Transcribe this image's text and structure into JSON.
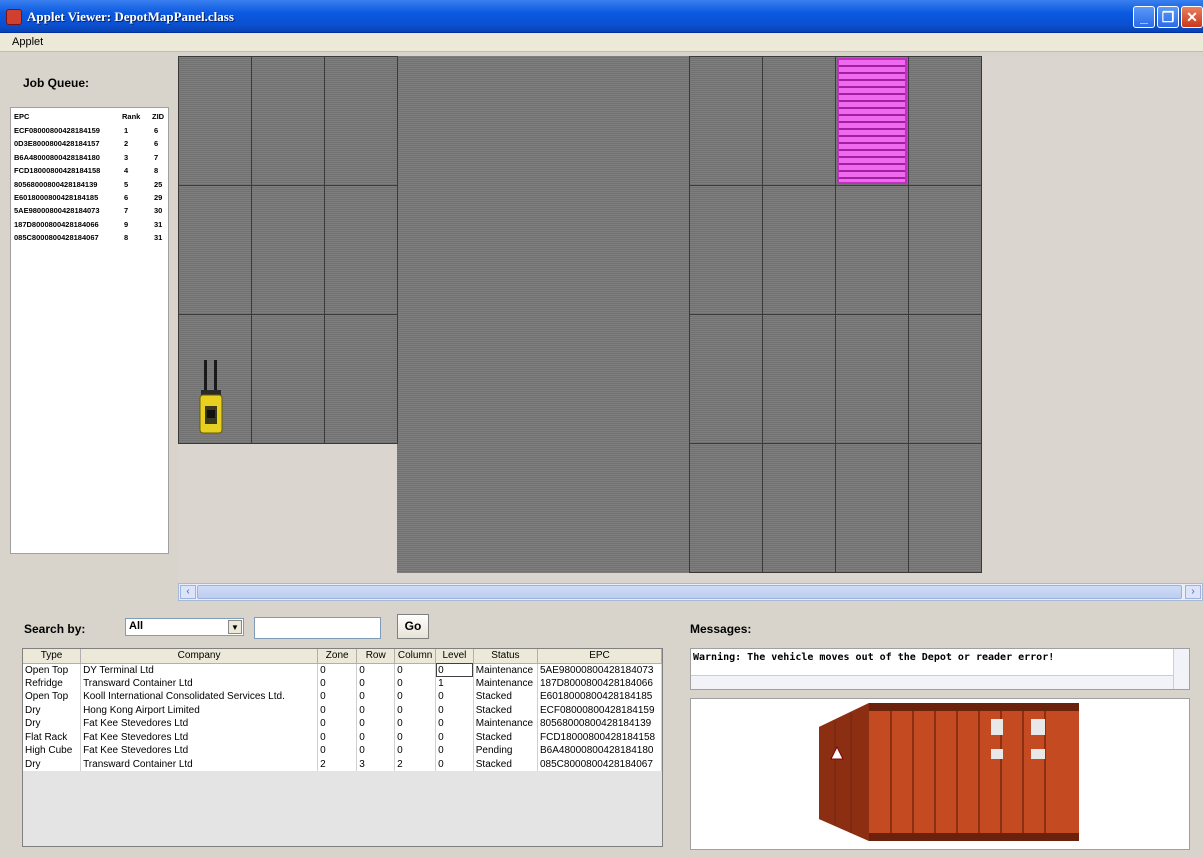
{
  "window": {
    "title": "Applet Viewer: DepotMapPanel.class"
  },
  "menu": {
    "items": [
      "Applet"
    ]
  },
  "job_queue": {
    "label": "Job Queue:",
    "columns": [
      "EPC",
      "Rank",
      "ZID"
    ],
    "rows": [
      {
        "epc": "ECF08000800428184159",
        "rank": "1",
        "zid": "6"
      },
      {
        "epc": "0D3E8000800428184157",
        "rank": "2",
        "zid": "6"
      },
      {
        "epc": "B6A48000800428184180",
        "rank": "3",
        "zid": "7"
      },
      {
        "epc": "FCD18000800428184158",
        "rank": "4",
        "zid": "8"
      },
      {
        "epc": "80568000800428184139",
        "rank": "5",
        "zid": "25"
      },
      {
        "epc": "E6018000800428184185",
        "rank": "6",
        "zid": "29"
      },
      {
        "epc": "5AE98000800428184073",
        "rank": "7",
        "zid": "30"
      },
      {
        "epc": "187D8000800428184066",
        "rank": "9",
        "zid": "31"
      },
      {
        "epc": "085C8000800428184067",
        "rank": "8",
        "zid": "31"
      }
    ]
  },
  "search": {
    "label": "Search by:",
    "selected": "All",
    "input_value": "",
    "go_label": "Go"
  },
  "results": {
    "columns": [
      "Type",
      "Company",
      "Zone",
      "Row",
      "Column",
      "Level",
      "Status",
      "EPC"
    ],
    "rows": [
      [
        "Open Top",
        "DY Terminal Ltd",
        "0",
        "0",
        "0",
        "0",
        "Maintenance",
        "5AE98000800428184073"
      ],
      [
        "Refridge",
        "Transward Container Ltd",
        "0",
        "0",
        "0",
        "1",
        "Maintenance",
        "187D8000800428184066"
      ],
      [
        "Open Top",
        " Kooll International Consolidated Services Ltd.",
        "0",
        "0",
        "0",
        "0",
        "Stacked",
        "E6018000800428184185"
      ],
      [
        "Dry",
        "Hong Kong Airport Limited",
        "0",
        "0",
        "0",
        "0",
        "Stacked",
        "ECF08000800428184159"
      ],
      [
        "Dry",
        "Fat Kee Stevedores Ltd",
        "0",
        "0",
        "0",
        "0",
        "Maintenance",
        "80568000800428184139"
      ],
      [
        "Flat Rack",
        "Fat Kee Stevedores Ltd",
        "0",
        "0",
        "0",
        "0",
        "Stacked",
        "FCD18000800428184158"
      ],
      [
        "High Cube",
        "Fat Kee Stevedores Ltd",
        "0",
        "0",
        "0",
        "0",
        "Pending",
        "B6A48000800428184180"
      ],
      [
        "Dry",
        "Transward Container Ltd",
        "2",
        "3",
        "2",
        "0",
        "Stacked",
        "085C8000800428184067"
      ]
    ]
  },
  "messages": {
    "label": "Messages:",
    "text": "Warning: The vehicle moves out of the Depot or reader error!"
  },
  "icons": {
    "app": "java-applet-icon",
    "minimize": "minimize-icon",
    "maximize": "restore-icon",
    "close": "close-icon"
  },
  "colors": {
    "titlebar": "#0b5ae0",
    "map_cell": "#767676",
    "container_highlight": "#f06af0",
    "forklift": "#e8d020",
    "shipping_container": "#b8401c"
  }
}
